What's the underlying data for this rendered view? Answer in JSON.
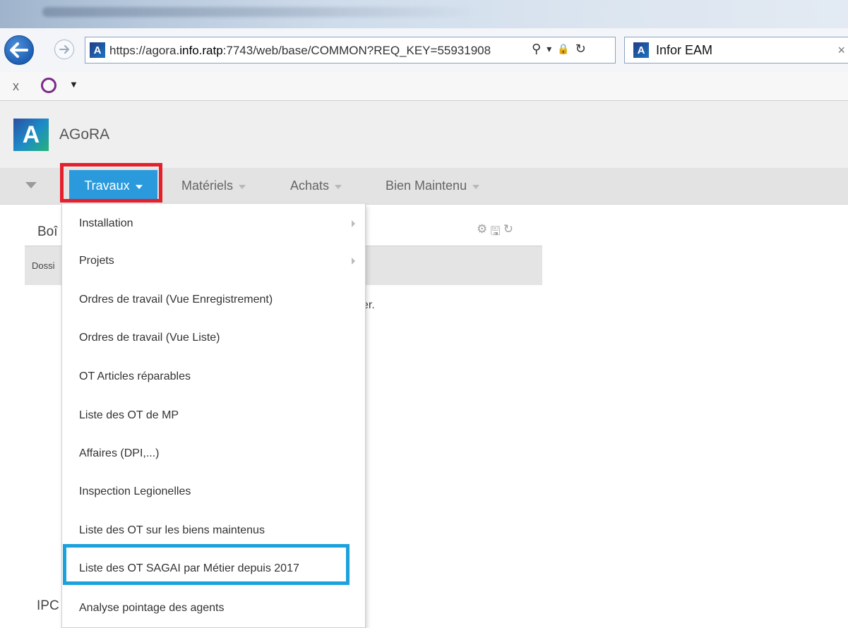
{
  "browser": {
    "url_prefix": "https://agora.",
    "url_host": "info.ratp",
    "url_suffix": ":7743/web/base/COMMON?REQ_KEY=55931908",
    "tab_title": "Infor EAM",
    "tab_close": "×",
    "search_glyph": "⚲",
    "dropdown_glyph": "▾",
    "lock_glyph": "🔒",
    "refresh_glyph": "↻",
    "site_icon_letter": "A",
    "cmd_close": "x",
    "cmd_caret": "▼"
  },
  "app": {
    "logo_letter": "A",
    "name": "AGoRA"
  },
  "menubar": {
    "items": [
      {
        "label": "Travaux"
      },
      {
        "label": "Matériels"
      },
      {
        "label": "Achats"
      },
      {
        "label": "Bien Maintenu"
      }
    ]
  },
  "page": {
    "panel_title": "Boî",
    "panel_tools": [
      "⚙",
      "🖫",
      "↻"
    ],
    "grid_column": "Dossi",
    "empty_text_fragment": "er.",
    "lower_label": "IPC"
  },
  "dropdown": {
    "items": [
      {
        "label": "Installation",
        "submenu": true
      },
      {
        "label": "Projets",
        "submenu": true
      },
      {
        "label": "Ordres de travail (Vue Enregistrement)",
        "submenu": false
      },
      {
        "label": "Ordres de travail (Vue Liste)",
        "submenu": false
      },
      {
        "label": "OT Articles réparables",
        "submenu": false
      },
      {
        "label": "Liste des OT de MP",
        "submenu": false
      },
      {
        "label": "Affaires (DPI,...)",
        "submenu": false
      },
      {
        "label": "Inspection Legionelles",
        "submenu": false
      },
      {
        "label": "Liste des OT sur les biens maintenus",
        "submenu": false
      },
      {
        "label": "Liste des OT SAGAI par Métier depuis 2017",
        "submenu": false
      },
      {
        "label": "Analyse pointage des agents",
        "submenu": false
      }
    ]
  },
  "colors": {
    "menu_active_bg": "#2b9adc",
    "red_highlight": "#e3202b",
    "blue_highlight": "#1ba2dc"
  }
}
